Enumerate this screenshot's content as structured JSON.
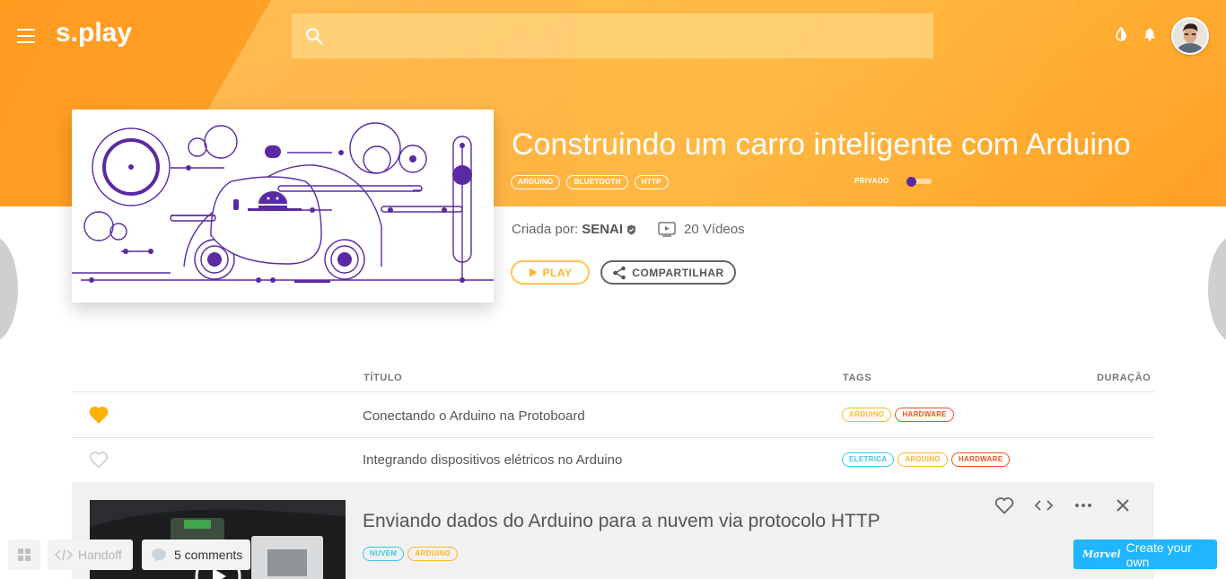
{
  "header": {
    "logo": "s.play",
    "search_placeholder": "",
    "icons": [
      "menu-icon",
      "search-icon",
      "contrast-icon",
      "bell-icon"
    ]
  },
  "course": {
    "title": "Construindo um carro inteligente com Arduino",
    "tags": [
      "ARDUINO",
      "BLUETOOTH",
      "HTTP"
    ],
    "private_label": "PRIVADO",
    "private_enabled": true,
    "created_by_label": "Criada por:",
    "creator": "SENAI",
    "videos_count": "20 Vídeos",
    "play_label": "PLAY",
    "share_label": "COMPARTILHAR"
  },
  "table": {
    "headers": {
      "title": "TÍTULO",
      "tags": "TAGS",
      "duration": "DURAÇÃO"
    },
    "rows": [
      {
        "favorite": true,
        "title": "Conectando o Arduino na Protoboard",
        "tags": [
          "ARDUINO",
          "HARDWARE"
        ]
      },
      {
        "favorite": false,
        "title": "Integrando dispositivos elétricos no Arduino",
        "tags": [
          "ELETRICA",
          "ARDUINO",
          "HARDWARE"
        ]
      }
    ],
    "expanded": {
      "title": "Enviando dados do Arduino para a nuvem via protocolo HTTP",
      "tags": [
        "NUVEM",
        "ARDUINO"
      ]
    }
  },
  "tag_colors": {
    "ARDUINO": "#ffb627",
    "HARDWARE": "#e8541e",
    "ELETRICA": "#3ec3ee",
    "NUVEM": "#3ec3ee"
  },
  "colors": {
    "accent": "#ffa42a",
    "purple": "#5a2aa3"
  },
  "marvel": {
    "handoff": "Handoff",
    "comments": "5 comments",
    "brand": "Marvel",
    "create": "Create your own"
  }
}
